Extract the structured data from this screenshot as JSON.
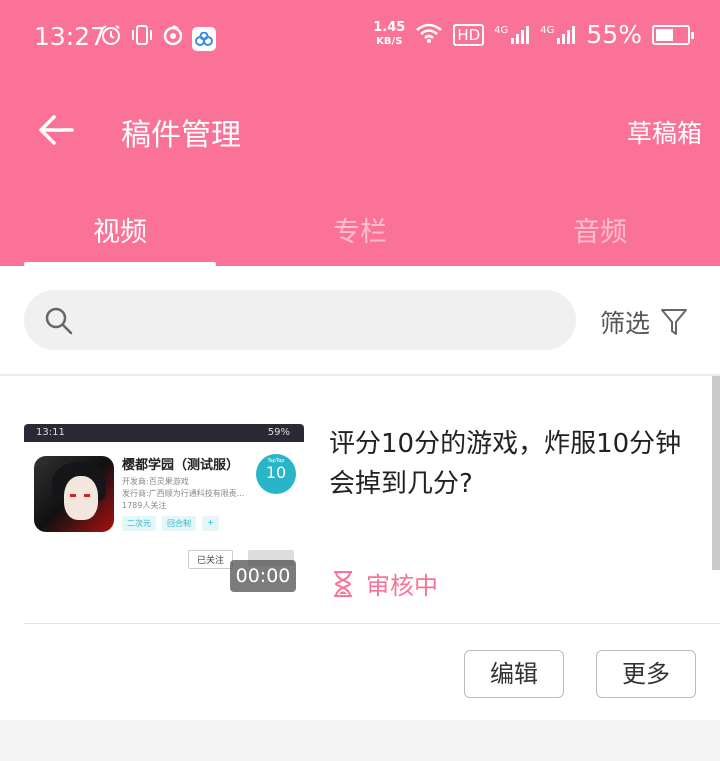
{
  "status_bar": {
    "time": "13:27",
    "net_speed_value": "1.45",
    "net_speed_unit": "KB/S",
    "hd_label": "HD",
    "sim1_label": "4G",
    "sim2_label": "4G",
    "battery_percent": "55%",
    "battery_level": 0.55
  },
  "nav": {
    "title": "稿件管理",
    "drafts_label": "草稿箱"
  },
  "tabs": [
    {
      "label": "视频",
      "active": true
    },
    {
      "label": "专栏",
      "active": false
    },
    {
      "label": "音频",
      "active": false
    }
  ],
  "search": {
    "placeholder": "",
    "filter_label": "筛选"
  },
  "video": {
    "thumbnail": {
      "status_time": "13:11",
      "status_pct": "59%",
      "game_title": "樱都学园（测试服）",
      "developer": "开发商:百灵果游戏",
      "publisher": "发行商:广西顺为行通科技有限责...",
      "followers": "1789人关注",
      "tags": [
        "二次元",
        "回合制",
        "+"
      ],
      "score_label": "TapTap",
      "score": "10",
      "follow_label": "已关注"
    },
    "duration": "00:00",
    "title": "评分10分的游戏，炸服10分钟会掉到几分?",
    "status": "审核中",
    "edit_label": "编辑",
    "more_label": "更多"
  },
  "colors": {
    "brand": "#fb7299"
  }
}
